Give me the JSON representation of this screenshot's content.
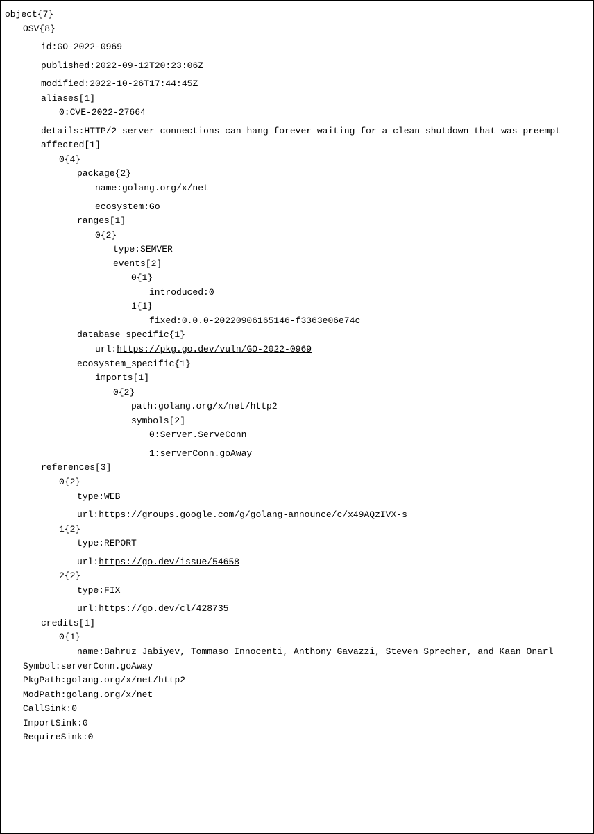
{
  "tree": {
    "root": "object{7}",
    "OSV": {
      "label": "OSV{8}",
      "id": {
        "key": "id:",
        "value": "GO-2022-0969"
      },
      "published": {
        "key": "published:",
        "value": "2022-09-12T20:23:06Z"
      },
      "modified": {
        "key": "modified:",
        "value": "2022-10-26T17:44:45Z"
      },
      "aliases": {
        "label": "aliases[1]",
        "item0": {
          "key": "0:",
          "value": "CVE-2022-27664"
        }
      },
      "details": {
        "key": "details:",
        "value": "HTTP/2 server connections can hang forever waiting for a clean shutdown that was preempt"
      },
      "affected": {
        "label": "affected[1]",
        "item0": {
          "label": "0{4}",
          "package": {
            "label": "package{2}",
            "name": {
              "key": "name:",
              "value": "golang.org/x/net"
            },
            "ecosystem": {
              "key": "ecosystem:",
              "value": "Go"
            }
          },
          "ranges": {
            "label": "ranges[1]",
            "item0": {
              "label": "0{2}",
              "type": {
                "key": "type:",
                "value": "SEMVER"
              },
              "events": {
                "label": "events[2]",
                "e0": {
                  "label": "0{1}",
                  "introduced": {
                    "key": "introduced:",
                    "value": "0"
                  }
                },
                "e1": {
                  "label": "1{1}",
                  "fixed": {
                    "key": "fixed:",
                    "value": "0.0.0-20220906165146-f3363e06e74c"
                  }
                }
              }
            }
          },
          "database_specific": {
            "label": "database_specific{1}",
            "url": {
              "key": "url:",
              "value": "https://pkg.go.dev/vuln/GO-2022-0969"
            }
          },
          "ecosystem_specific": {
            "label": "ecosystem_specific{1}",
            "imports": {
              "label": "imports[1]",
              "item0": {
                "label": "0{2}",
                "path": {
                  "key": "path:",
                  "value": "golang.org/x/net/http2"
                },
                "symbols": {
                  "label": "symbols[2]",
                  "s0": {
                    "key": "0:",
                    "value": "Server.ServeConn"
                  },
                  "s1": {
                    "key": "1:",
                    "value": "serverConn.goAway"
                  }
                }
              }
            }
          }
        }
      },
      "references": {
        "label": "references[3]",
        "r0": {
          "label": "0{2}",
          "type": {
            "key": "type:",
            "value": "WEB"
          },
          "url": {
            "key": "url:",
            "value": "https://groups.google.com/g/golang-announce/c/x49AQzIVX-s"
          }
        },
        "r1": {
          "label": "1{2}",
          "type": {
            "key": "type:",
            "value": "REPORT"
          },
          "url": {
            "key": "url:",
            "value": "https://go.dev/issue/54658"
          }
        },
        "r2": {
          "label": "2{2}",
          "type": {
            "key": "type:",
            "value": "FIX"
          },
          "url": {
            "key": "url:",
            "value": "https://go.dev/cl/428735"
          }
        }
      },
      "credits": {
        "label": "credits[1]",
        "c0": {
          "label": "0{1}",
          "name": {
            "key": "name:",
            "value": "Bahruz Jabiyev, Tommaso Innocenti, Anthony Gavazzi, Steven Sprecher, and Kaan Onarl"
          }
        }
      }
    },
    "Symbol": {
      "key": "Symbol:",
      "value": "serverConn.goAway"
    },
    "PkgPath": {
      "key": "PkgPath:",
      "value": "golang.org/x/net/http2"
    },
    "ModPath": {
      "key": "ModPath:",
      "value": "golang.org/x/net"
    },
    "CallSink": {
      "key": "CallSink:",
      "value": "0"
    },
    "ImportSink": {
      "key": "ImportSink:",
      "value": "0"
    },
    "RequireSink": {
      "key": "RequireSink:",
      "value": "0"
    }
  }
}
